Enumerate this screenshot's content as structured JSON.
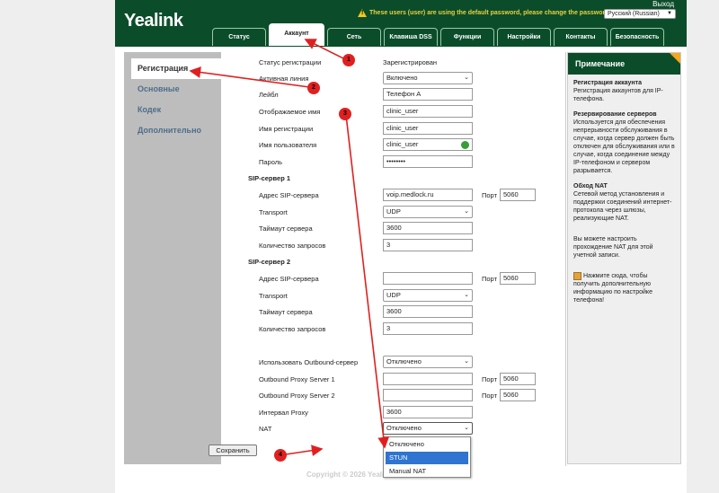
{
  "header": {
    "logo": "Yealink",
    "logout": "Выход",
    "warning": "These users (user) are using the default password, please change the password!",
    "language": "Русский (Russian)"
  },
  "tabs": [
    {
      "label": "Статус",
      "active": false
    },
    {
      "label": "Аккаунт",
      "active": true
    },
    {
      "label": "Сеть",
      "active": false
    },
    {
      "label": "Клавиша DSS",
      "active": false
    },
    {
      "label": "Функции",
      "active": false
    },
    {
      "label": "Настройки",
      "active": false
    },
    {
      "label": "Контакты",
      "active": false
    },
    {
      "label": "Безопасность",
      "active": false
    }
  ],
  "sidebar": {
    "items": [
      {
        "label": "Регистрация",
        "active": true
      },
      {
        "label": "Основные",
        "active": false
      },
      {
        "label": "Кодек",
        "active": false
      },
      {
        "label": "Дополнительно",
        "active": false
      }
    ]
  },
  "form": {
    "reg_status_label": "Статус регистрации",
    "reg_status_value": "Зарегистрирован",
    "active_line_label": "Активная линия",
    "active_line_value": "Включено",
    "label_label": "Лейбл",
    "label_value": "Телефон А",
    "display_name_label": "Отображаемое имя",
    "display_name_value": "clinic_user",
    "register_name_label": "Имя регистрации",
    "register_name_value": "clinic_user",
    "username_label": "Имя пользователя",
    "username_value": "clinic_user",
    "password_label": "Пароль",
    "password_value": "••••••••",
    "sip1_section": "SIP-сервер 1",
    "sip1_address_label": "Адрес SIP-сервера",
    "sip1_address_value": "voip.medlock.ru",
    "port_label": "Порт",
    "sip1_port_value": "5060",
    "sip1_transport_label": "Transport",
    "sip1_transport_value": "UDP",
    "sip1_timeout_label": "Таймаут сервера",
    "sip1_timeout_value": "3600",
    "sip1_retry_label": "Количество запросов",
    "sip1_retry_value": "3",
    "sip2_section": "SIP-сервер 2",
    "sip2_address_label": "Адрес SIP-сервера",
    "sip2_address_value": "",
    "sip2_port_value": "5060",
    "sip2_transport_label": "Transport",
    "sip2_transport_value": "UDP",
    "sip2_timeout_label": "Таймаут сервера",
    "sip2_timeout_value": "3600",
    "sip2_retry_label": "Количество запросов",
    "sip2_retry_value": "3",
    "outbound_label": "Использовать Outbound-сервер",
    "outbound_value": "Отключено",
    "proxy1_label": "Outbound Proxy Server 1",
    "proxy1_value": "",
    "proxy1_port": "5060",
    "proxy2_label": "Outbound Proxy Server 2",
    "proxy2_value": "",
    "proxy2_port": "5060",
    "proxy_interval_label": "Интервал Proxy",
    "proxy_interval_value": "3600",
    "nat_label": "NAT",
    "nat_value": "Отключено",
    "nat_options": [
      "Отключено",
      "STUN",
      "Manual NAT"
    ],
    "nat_highlighted": "STUN",
    "save_label": "Сохранить"
  },
  "note": {
    "title": "Примечание",
    "h1": "Регистрация аккаунта",
    "p1": "Регистрация аккаунтов для IP-телефона.",
    "h2": "Резервирование серверов",
    "p2": "Используется для обеспечения непрерывности обслуживания в случае, когда сервер должен быть отключен для обслуживания или в случае, когда соединение между IP-телефоном и сервером разрывается.",
    "h3": "Обход NAT",
    "p3": "Сетевой метод установления и поддержки соединений интернет-протокола через шлюзы, реализующие NAT.",
    "p4": "Вы можете настроить прохождение NAT для этой учетной записи.",
    "p5": "Нажмите сюда, чтобы получить дополнительную информацию по настройке телефона!"
  },
  "footer": {
    "copyright": "Copyright © 2026 Yealink ... ены."
  },
  "annotations": [
    "1",
    "2",
    "3",
    "4"
  ],
  "colors": {
    "header_green": "#0b4d2a",
    "annotation_red": "#e02020",
    "warning_yellow": "#e8d040",
    "dropdown_highlight": "#2f74d0"
  }
}
